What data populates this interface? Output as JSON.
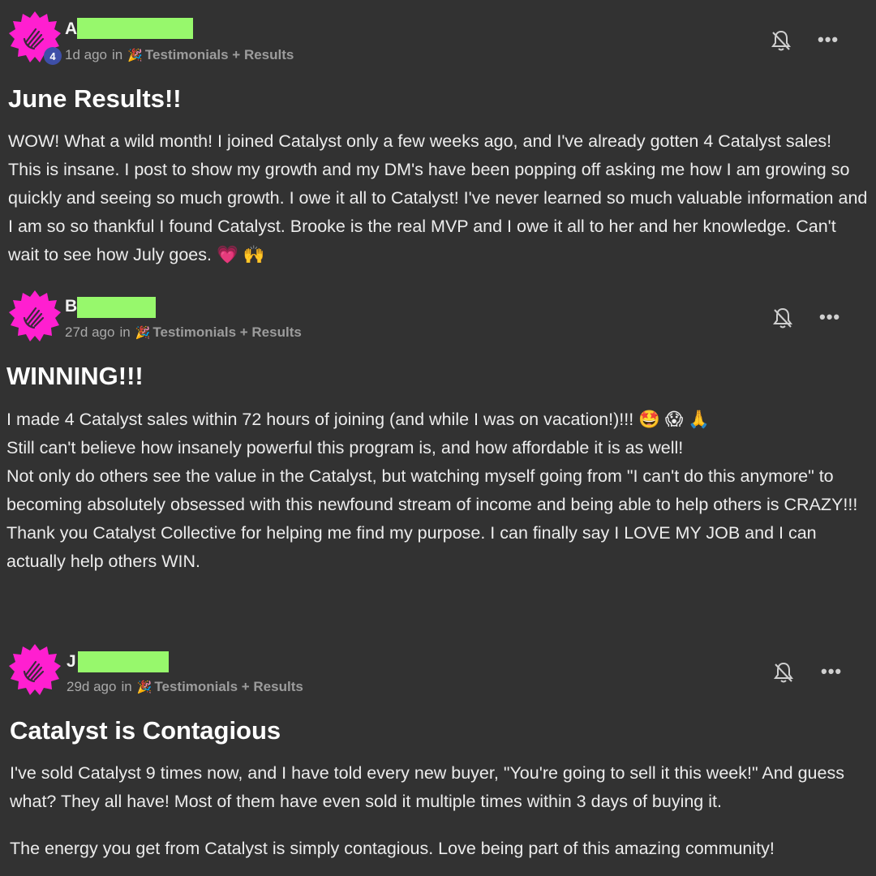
{
  "posts": [
    {
      "author_initial": "A",
      "level": "4",
      "time": "1d ago",
      "in_text": "in",
      "group_emoji": "🎉",
      "group": "Testimonials + Results",
      "title": "June Results!!",
      "body_lines": [
        "WOW! What a wild month! I joined Catalyst only a few weeks ago, and I've already gotten 4 Catalyst sales! This is insane. I post to show my growth and my DM's have been popping off asking me how I am growing so quickly and seeing so much growth. I owe it all to Catalyst! I've never learned so much valuable information and I am so so thankful I found Catalyst. Brooke is the real MVP and I owe it all to her and her knowledge. Can't wait to see how July goes. 💗 🙌"
      ],
      "more_label": "•••"
    },
    {
      "author_initial": "B",
      "level": "",
      "time": "27d ago",
      "in_text": "in",
      "group_emoji": "🎉",
      "group": "Testimonials + Results",
      "title": "WINNING!!!",
      "body_lines": [
        "I made 4 Catalyst sales within 72 hours of joining (and while I was on vacation!)!!! 🤩 😱 🙏",
        "Still can't believe how insanely powerful this program is, and how affordable it is as well!",
        "Not only do others see the value in the Catalyst, but watching myself going from \"I can't do this anymore\" to becoming absolutely obsessed with this newfound stream of income and being able to help others is CRAZY!!!",
        "Thank you Catalyst Collective for helping me find my purpose. I can finally say I LOVE MY JOB and I can actually help others WIN."
      ],
      "more_label": "•••"
    },
    {
      "author_initial": "J",
      "level": "",
      "time": "29d ago",
      "in_text": "in",
      "group_emoji": "🎉",
      "group": "Testimonials + Results",
      "title": "Catalyst is Contagious",
      "body_lines": [
        "I've sold Catalyst 9 times now, and I have told every new buyer, \"You're going to sell it this week!\" And guess what? They all have! Most of them have even sold it multiple times within 3 days of buying it.",
        "The energy you get from Catalyst is simply contagious. Love being part of this amazing community!"
      ],
      "more_label": "•••"
    }
  ],
  "colors": {
    "background": "#323232",
    "avatar_pink": "#ff1fd0",
    "redaction": "#97f86c",
    "badge": "#3e4fa8"
  },
  "icons": [
    "notification-off-icon",
    "more-options-icon",
    "party-popper-icon"
  ]
}
